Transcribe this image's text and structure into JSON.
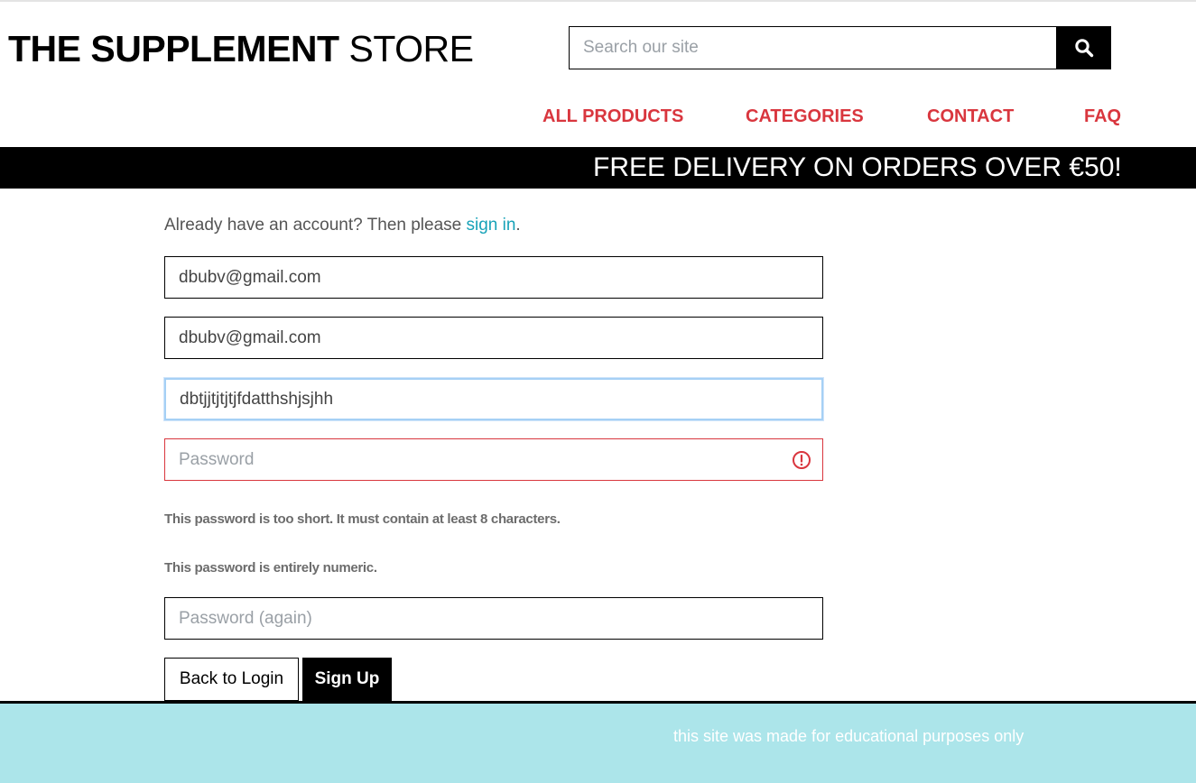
{
  "header": {
    "logo_bold": "THE SUPPLEMENT",
    "logo_light": "STORE",
    "search_placeholder": "Search our site",
    "search_icon": "search-icon"
  },
  "nav": {
    "items": [
      "ALL PRODUCTS",
      "CATEGORIES",
      "CONTACT",
      "FAQ"
    ],
    "color": "#d9363e"
  },
  "banner": {
    "text": "FREE DELIVERY ON ORDERS OVER €50!"
  },
  "signup": {
    "already_prefix": "Already have an account? Then please ",
    "sign_in_link": "sign in",
    "already_suffix": ".",
    "email_value": "dbubv@gmail.com",
    "email_confirm_value": "dbubv@gmail.com",
    "username_value": "dbtjjtjtjtjfdatthshjsjhh",
    "password_placeholder": "Password",
    "password_again_placeholder": "Password (again)",
    "errors": [
      "This password is too short. It must contain at least 8 characters.",
      "This password is entirely numeric."
    ],
    "back_button": "Back to Login",
    "signup_button": "Sign Up",
    "error_icon": "alert-circle-icon"
  },
  "footer": {
    "text": "this site was made for educational purposes only",
    "bg": "#ace5ea"
  }
}
